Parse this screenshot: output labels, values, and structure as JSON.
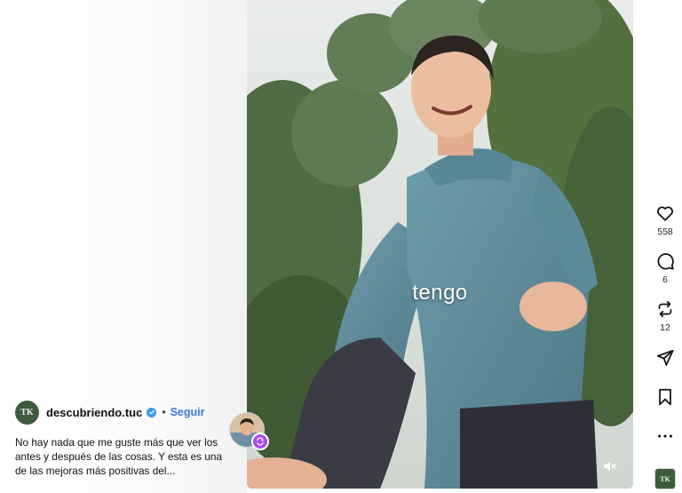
{
  "post": {
    "author": {
      "avatar_text": "TK",
      "username": "descubriendo.tuc",
      "verified": true,
      "separator": "•",
      "follow_label": "Seguir"
    },
    "caption": "No hay nada que me guste más que ver los antes y después de las cosas. Y esta es una de las mejoras más positivas del..."
  },
  "video": {
    "subtitle": "tengo",
    "muted": true
  },
  "actions": {
    "likes": "558",
    "comments": "6",
    "reposts": "12"
  },
  "audio": {
    "thumb_text": "TK"
  },
  "colors": {
    "follow": "#3e78d6",
    "verified": "#3897f0",
    "remix_badge": "#a64bf4",
    "brand_green": "#3d5c3e"
  },
  "icons": [
    "heart-icon",
    "comment-icon",
    "repost-icon",
    "share-icon",
    "save-icon",
    "more-icon",
    "mute-icon",
    "verified-icon",
    "remix-icon"
  ]
}
